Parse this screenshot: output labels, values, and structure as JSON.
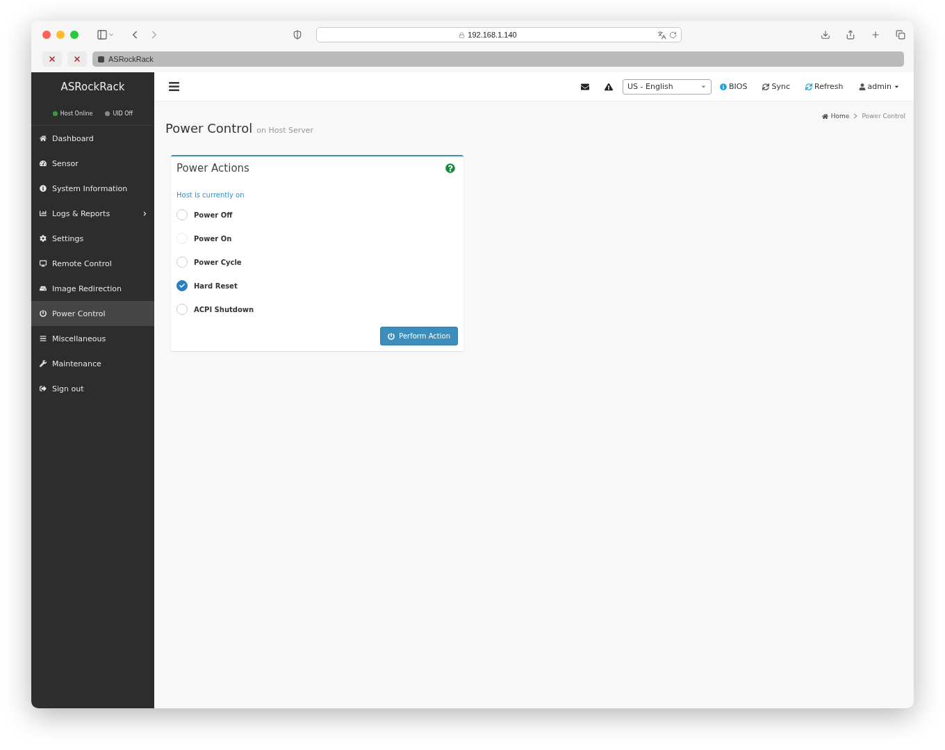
{
  "browser": {
    "address": "192.168.1.140",
    "tabs": [
      {
        "kind": "pinned",
        "selected": false
      },
      {
        "kind": "pinned",
        "selected": false
      },
      {
        "kind": "tab",
        "title": "ASRockRack",
        "selected": true
      }
    ]
  },
  "sidebar": {
    "brand": "ASRockRack",
    "status": [
      {
        "label": "Host Online",
        "color": "#3c9a3c"
      },
      {
        "label": "UID Off",
        "color": "#8a8a8a"
      }
    ],
    "items": [
      {
        "label": "Dashboard",
        "kind": "link",
        "selected": false
      },
      {
        "label": "Sensor",
        "kind": "link",
        "selected": false
      },
      {
        "label": "System Information",
        "kind": "link",
        "selected": false
      },
      {
        "label": "Logs & Reports",
        "kind": "group",
        "expanded": false,
        "selected": false
      },
      {
        "label": "Settings",
        "kind": "link",
        "selected": false
      },
      {
        "label": "Remote Control",
        "kind": "link",
        "selected": false
      },
      {
        "label": "Image Redirection",
        "kind": "link",
        "selected": false
      },
      {
        "label": "Power Control",
        "kind": "link",
        "selected": true
      },
      {
        "label": "Miscellaneous",
        "kind": "link",
        "selected": false
      },
      {
        "label": "Maintenance",
        "kind": "link",
        "selected": false
      },
      {
        "label": "Sign out",
        "kind": "link",
        "selected": false
      }
    ]
  },
  "navbar": {
    "language": "US - English",
    "links": [
      "BIOS",
      "Sync",
      "Refresh"
    ],
    "user": "admin"
  },
  "page": {
    "title": "Power Control",
    "subtitle": "on Host Server",
    "breadcrumb": [
      "Home",
      "Power Control"
    ]
  },
  "panel": {
    "title": "Power Actions",
    "status": "Host is currently on",
    "options": [
      {
        "label": "Power Off",
        "selected": false,
        "disabled": false
      },
      {
        "label": "Power On",
        "selected": false,
        "disabled": true
      },
      {
        "label": "Power Cycle",
        "selected": false,
        "disabled": false
      },
      {
        "label": "Hard Reset",
        "selected": true,
        "disabled": false
      },
      {
        "label": "ACPI Shutdown",
        "selected": false,
        "disabled": false
      }
    ],
    "button": "Perform Action"
  }
}
